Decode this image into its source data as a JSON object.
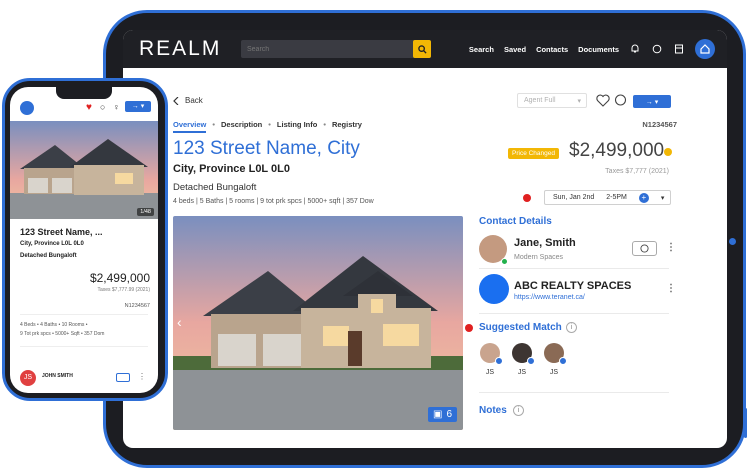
{
  "tablet": {
    "logo": "REALM",
    "search_placeholder": "Search",
    "nav": [
      "Search",
      "Saved",
      "Contacts",
      "Documents"
    ],
    "back_label": "Back",
    "agent_select": "Agent Full",
    "tabs": [
      "Overview",
      "Description",
      "Listing Info",
      "Registry"
    ],
    "listing_id": "N1234567",
    "address": "123 Street Name, City",
    "city_postal": "City, Province L0L 0L0",
    "property_type": "Detached Bungaloft",
    "specs": "4 beds | 5 Baths | 5 rooms | 9 tot prk spcs | 5000+ sqft | 357 Dow",
    "price_badge": "Price Changed",
    "price": "$2,499,000",
    "taxes": "Taxes $7,777 (2021)",
    "date": "Sun, Jan 2nd",
    "time": "2-5PM",
    "photo_count": "6",
    "contact_title": "Contact Details",
    "agent_name": "Jane, Smith",
    "agent_company": "Modern Spaces",
    "brokerage_name": "ABC REALTY SPACES",
    "brokerage_url": "https://www.teranet.ca/",
    "suggested_title": "Suggested Match",
    "matches": [
      "JS",
      "JS",
      "JS"
    ],
    "notes_title": "Notes"
  },
  "phone": {
    "photo_counter": "1/48",
    "address": "123 Street Name, ...",
    "city_postal": "City, Province L0L 0L0",
    "property_type": "Detached Bungaloft",
    "price": "$2,499,000",
    "taxes": "Taxes $7,777.99 (2021)",
    "listing_id": "N1234567",
    "specs_line1": "4 Beds  •  4 Baths  •  10 Rooms  •",
    "specs_line2": "9 Tot prk spcs  •  5000+ Sqft  •  357 Dom",
    "agent_initials": "JS",
    "agent_name": "JOHN SMITH"
  },
  "colors": {
    "accent": "#2f6fd6",
    "yellow": "#f2b705",
    "red": "#e02020",
    "dark": "#1f2025"
  }
}
